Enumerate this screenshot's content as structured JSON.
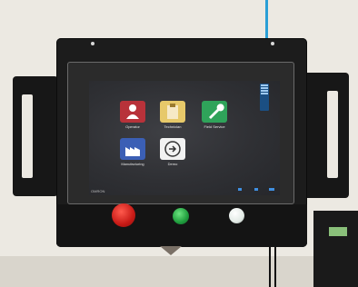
{
  "colors": {
    "wall": "#ece9e2",
    "housing": "#1c1c1c",
    "screen": "#2f3034",
    "cable": "#2a9fd6",
    "operator_tile": "#b8323a",
    "technician_tile": "#e7c96a",
    "field_service_tile": "#2fa35a",
    "manufacturing_tile": "#3b5fb5",
    "demo_tile": "#f2f2f2",
    "red_button": "#d8241f",
    "green_button": "#27b24a",
    "white_button": "#f4f6f4"
  },
  "screen": {
    "apps": [
      {
        "label": "Operator",
        "icon": "person-icon"
      },
      {
        "label": "Technician",
        "icon": "clipboard-icon"
      },
      {
        "label": "Field Service",
        "icon": "wrench-icon"
      },
      {
        "label": "Manufacturing",
        "icon": "factory-icon"
      },
      {
        "label": "Demo",
        "icon": "arrow-right-icon"
      }
    ],
    "brand": "OMRON"
  },
  "buttons": [
    {
      "name": "red-button",
      "color": "red"
    },
    {
      "name": "green-button",
      "color": "green"
    },
    {
      "name": "white-button",
      "color": "white"
    }
  ]
}
